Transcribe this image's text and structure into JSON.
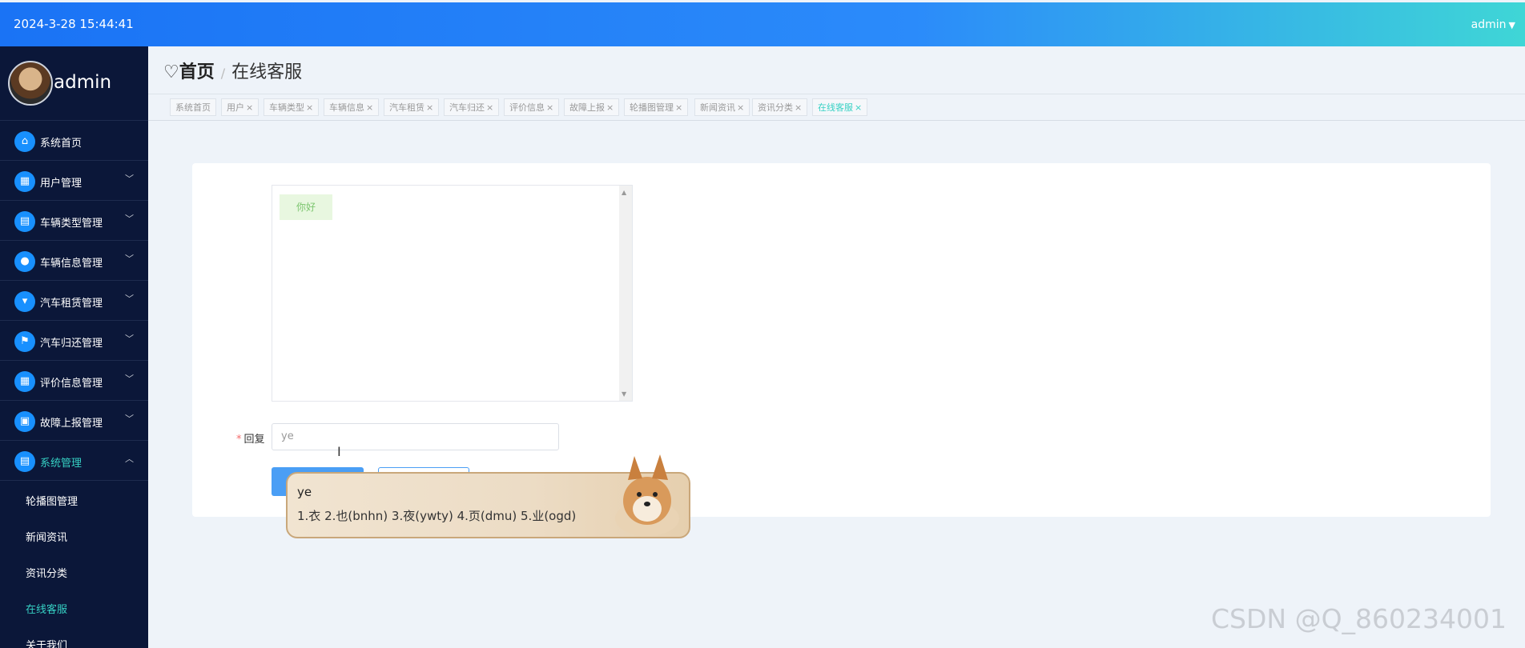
{
  "header": {
    "datetime": "2024-3-28 15:44:41",
    "user": "admin",
    "caret": "▼"
  },
  "sidebar": {
    "username": "admin",
    "items": [
      {
        "label": "系统首页",
        "icon": "⌂"
      },
      {
        "label": "用户管理",
        "icon": "▦"
      },
      {
        "label": "车辆类型管理",
        "icon": "▤"
      },
      {
        "label": "车辆信息管理",
        "icon": "●"
      },
      {
        "label": "汽车租赁管理",
        "icon": "▾"
      },
      {
        "label": "汽车归还管理",
        "icon": "⚑"
      },
      {
        "label": "评价信息管理",
        "icon": "▦"
      },
      {
        "label": "故障上报管理",
        "icon": "▣"
      },
      {
        "label": "系统管理",
        "icon": "▤"
      }
    ],
    "sub_items": [
      "轮播图管理",
      "新闻资讯",
      "资讯分类",
      "在线客服",
      "关于我们"
    ]
  },
  "breadcrumb": {
    "home": "首页",
    "current": "在线客服"
  },
  "tabs": [
    "系统首页",
    "用户",
    "车辆类型",
    "车辆信息",
    "汽车租赁",
    "汽车归还",
    "评价信息",
    "故障上报",
    "轮播图管理",
    "新闻资讯",
    "资讯分类",
    "在线客服"
  ],
  "chat": {
    "message": "你好"
  },
  "form": {
    "required_mark": "*",
    "reply_label": "回复",
    "reply_value": "ye"
  },
  "ime": {
    "typed": "ye",
    "candidates": "1.衣  2.也(bnhn)  3.夜(ywty)  4.页(dmu)  5.业(ogd)"
  },
  "watermark": "CSDN @Q_860234001"
}
